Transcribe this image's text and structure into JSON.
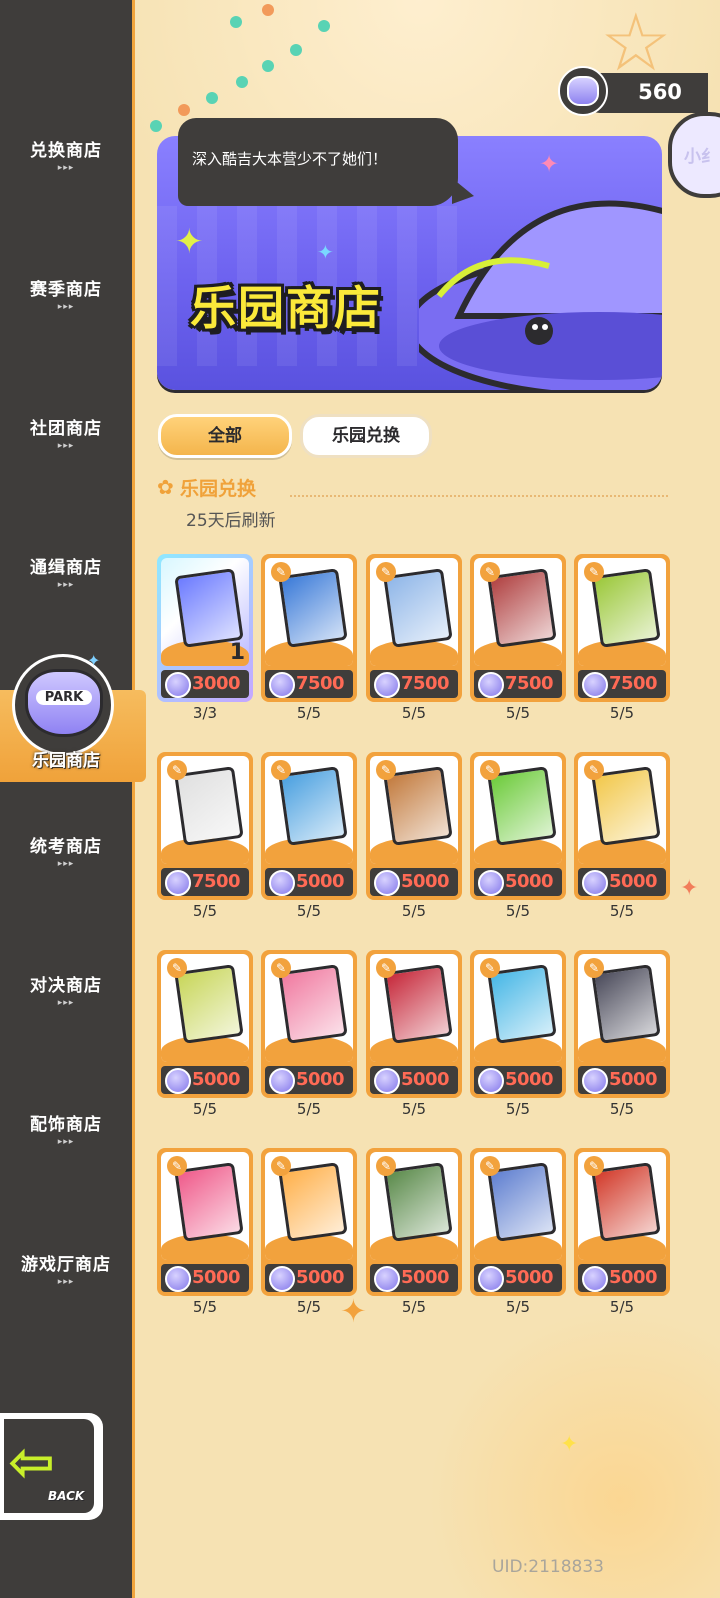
{
  "sidebar": {
    "items": [
      {
        "label": "兑换商店"
      },
      {
        "label": "赛季商店"
      },
      {
        "label": "社团商店"
      },
      {
        "label": "通缉商店"
      },
      {
        "label": "乐园商店",
        "active": true,
        "badge_text": "PARK"
      },
      {
        "label": "统考商店"
      },
      {
        "label": "对决商店"
      },
      {
        "label": "配饰商店"
      },
      {
        "label": "游戏厅商店"
      }
    ],
    "arrows": "▸▸▸",
    "back_label": "BACK"
  },
  "currency": {
    "value": "560",
    "icon": "park-coin-icon"
  },
  "side_button": {
    "label": "小纟"
  },
  "banner": {
    "title": "乐园商店",
    "speech": "深入酷吉大本营少不了她们！"
  },
  "tabs": [
    {
      "label": "全部",
      "selected": true
    },
    {
      "label": "乐园兑换",
      "selected": false
    }
  ],
  "section": {
    "title": "乐园兑换",
    "refresh": "25天后刷新"
  },
  "items": [
    {
      "price": "3000",
      "count": "3/3",
      "qty": "1",
      "special": true,
      "color": "#6c7bff"
    },
    {
      "price": "7500",
      "count": "5/5",
      "color": "#3a7ad8"
    },
    {
      "price": "7500",
      "count": "5/5",
      "color": "#8fb6e8"
    },
    {
      "price": "7500",
      "count": "5/5",
      "color": "#b04141"
    },
    {
      "price": "7500",
      "count": "5/5",
      "color": "#9bc83a"
    },
    {
      "price": "7500",
      "count": "5/5",
      "color": "#e0e0e0"
    },
    {
      "price": "5000",
      "count": "5/5",
      "color": "#4aa0e0"
    },
    {
      "price": "5000",
      "count": "5/5",
      "color": "#c27a3d"
    },
    {
      "price": "5000",
      "count": "5/5",
      "color": "#6dcb3b"
    },
    {
      "price": "5000",
      "count": "5/5",
      "color": "#f2c84b"
    },
    {
      "price": "5000",
      "count": "5/5",
      "color": "#c8d65a"
    },
    {
      "price": "5000",
      "count": "5/5",
      "color": "#f07aa0"
    },
    {
      "price": "5000",
      "count": "5/5",
      "color": "#c6283a"
    },
    {
      "price": "5000",
      "count": "5/5",
      "color": "#47b7e6"
    },
    {
      "price": "5000",
      "count": "5/5",
      "color": "#4a4a5a"
    },
    {
      "price": "5000",
      "count": "5/5",
      "color": "#ef5a8a"
    },
    {
      "price": "5000",
      "count": "5/5",
      "color": "#ffb04a"
    },
    {
      "price": "5000",
      "count": "5/5",
      "color": "#5a8a4a"
    },
    {
      "price": "5000",
      "count": "5/5",
      "color": "#5f7fd0"
    },
    {
      "price": "5000",
      "count": "5/5",
      "color": "#d23a2a"
    }
  ],
  "uid": "UID:2118833"
}
